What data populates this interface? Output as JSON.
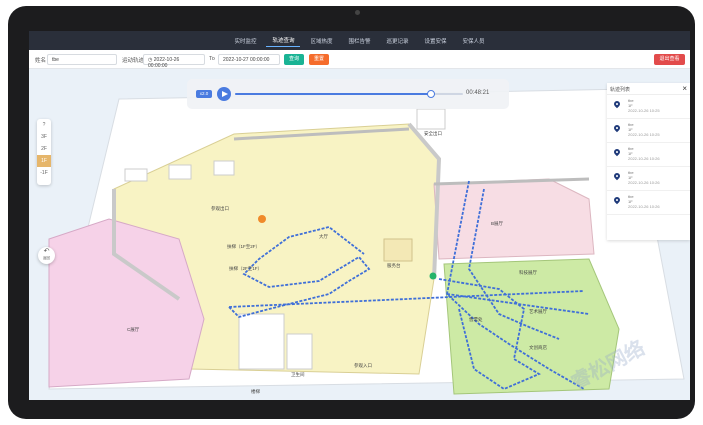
{
  "nav": [
    "实时监控",
    "轨迹查询",
    "区域热度",
    "围栏告警",
    "巡更记录",
    "设置安保",
    "安保人员"
  ],
  "nav_active": 1,
  "filter": {
    "name_label": "姓名",
    "name_value": "tbe",
    "time_label": "运动轨迹",
    "from": "2022-10-26 00:00:00",
    "to_label": "To",
    "to": "2022-10-27 00:00:00",
    "query_btn": "查询",
    "reset_btn": "重置",
    "exit_btn": "退出查看"
  },
  "floors": [
    "3F",
    "2F",
    "1F",
    "-1F"
  ],
  "floor_active": 2,
  "back_label": "返回",
  "player": {
    "speed": "x2.0",
    "time": "00:48:21",
    "progress": 0.86
  },
  "panel": {
    "title": "轨迹列表",
    "close": "×",
    "items": [
      {
        "name": "tbe",
        "floor": "1F",
        "time": "2022-10-26 10:25"
      },
      {
        "name": "tbe",
        "floor": "1F",
        "time": "2022-10-26 10:25"
      },
      {
        "name": "tbe",
        "floor": "1F",
        "time": "2022-10-26 10:26"
      },
      {
        "name": "tbe",
        "floor": "1F",
        "time": "2022-10-26 10:26"
      },
      {
        "name": "tbe",
        "floor": "1F",
        "time": "2022-10-26 10:26"
      }
    ]
  },
  "map_labels": {
    "entrance": "参观出口",
    "hall": "大厅",
    "stair1": "扶梯（1F至2F）",
    "stair2": "扶梯（2F至1F）",
    "service": "服务台",
    "left_hall": "C展厅",
    "right_hall": "B展厅",
    "toilet": "卫生间",
    "stairs": "楼梯",
    "visit_entry": "参观入口",
    "exhibit1": "科技展厅",
    "exhibit2": "艺术展厅",
    "ticket": "售票处",
    "shop": "文创商店",
    "exit2": "安全出口"
  },
  "watermark": "睿松网络",
  "colors": {
    "accent": "#4a7be0",
    "query": "#19b394",
    "reset": "#f56c2c",
    "exit": "#e24b4b",
    "path": "#3f6fd8",
    "pink": "#f6d2e8",
    "yellow": "#f8f3c4",
    "green": "#cdeaa5",
    "rose": "#f7dde4"
  }
}
